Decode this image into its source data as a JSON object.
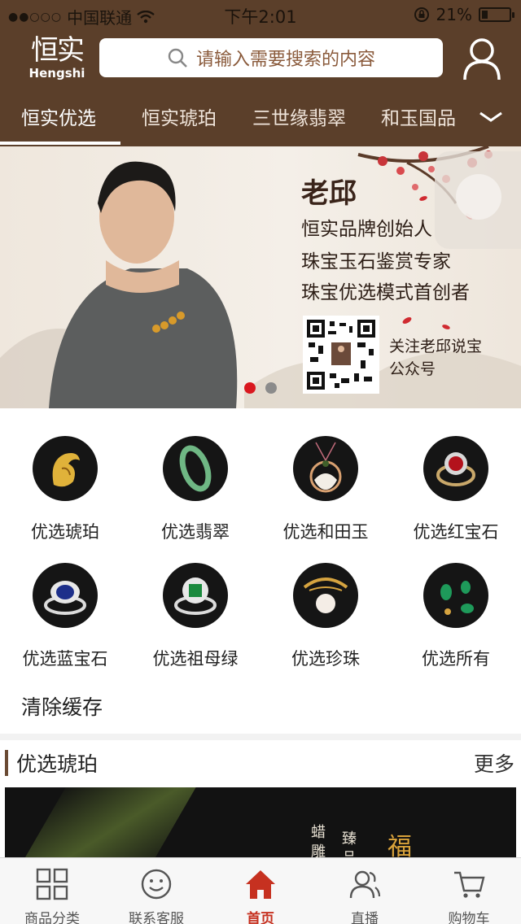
{
  "status_bar": {
    "carrier": "中国联通",
    "time": "下午2:01",
    "battery": "21%",
    "battery_level": 0.21
  },
  "header": {
    "logo_cn": "恒实",
    "logo_en": "Hengshi",
    "search_placeholder": "请输入需要搜索的内容",
    "user_icon": "user-icon"
  },
  "tabs": [
    {
      "label": "恒实优选",
      "active": true
    },
    {
      "label": "恒实琥珀"
    },
    {
      "label": "三世缘翡翠"
    },
    {
      "label": "和玉国品"
    }
  ],
  "banner": {
    "name": "老邱",
    "lines": [
      "恒实品牌创始人",
      "珠宝玉石鉴赏专家",
      "珠宝优选模式首创者"
    ],
    "qr_caption_1": "关注老邱说宝",
    "qr_caption_2": "公众号",
    "slide_count": 2,
    "active_slide": 1
  },
  "categories": [
    {
      "label": "优选琥珀",
      "icon": "amber-icon"
    },
    {
      "label": "优选翡翠",
      "icon": "jade-bangle-icon"
    },
    {
      "label": "优选和田玉",
      "icon": "hetian-jade-pendant-icon"
    },
    {
      "label": "优选红宝石",
      "icon": "ruby-ring-icon"
    },
    {
      "label": "优选蓝宝石",
      "icon": "sapphire-ring-icon"
    },
    {
      "label": "优选祖母绿",
      "icon": "emerald-ring-icon"
    },
    {
      "label": "优选珍珠",
      "icon": "pearl-ring-icon"
    },
    {
      "label": "优选所有",
      "icon": "jade-earrings-icon"
    }
  ],
  "clear_cache": "清除缓存",
  "section": {
    "title": "优选琥珀",
    "more": "更多"
  },
  "promo": {
    "text_1": "蜡雕",
    "text_2": "臻品",
    "text_3": "福"
  },
  "bottom_nav": [
    {
      "label": "商品分类",
      "icon": "grid-icon"
    },
    {
      "label": "联系客服",
      "icon": "smiley-icon"
    },
    {
      "label": "首页",
      "icon": "home-icon",
      "active": true
    },
    {
      "label": "直播",
      "icon": "people-icon"
    },
    {
      "label": "购物车",
      "icon": "cart-icon"
    }
  ],
  "colors": {
    "brand_brown": "#5b3f2a",
    "active_red": "#c63120",
    "search_text": "#8a5a3b"
  }
}
